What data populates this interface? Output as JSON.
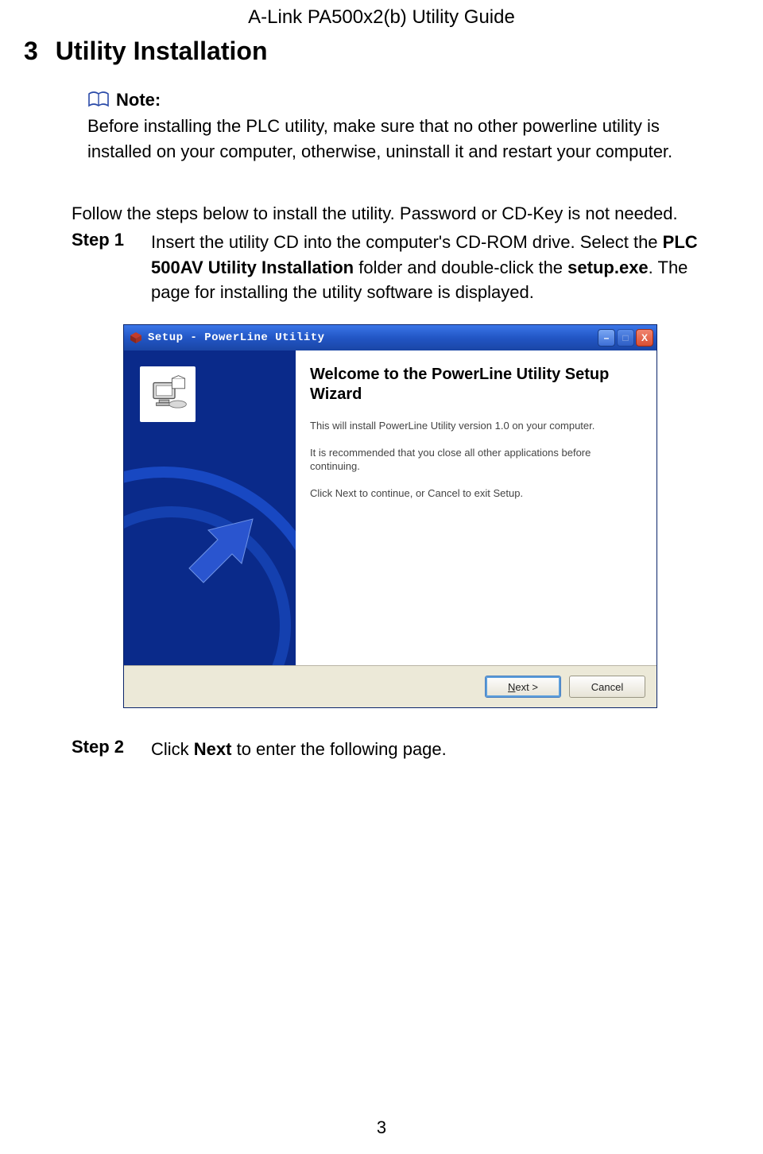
{
  "header": {
    "title": "A-Link PA500x2(b) Utility Guide"
  },
  "section": {
    "number": "3",
    "title": "Utility Installation"
  },
  "note": {
    "label": "Note:",
    "text": "Before installing the PLC utility, make sure that no other powerline utility is installed on your computer, otherwise, uninstall it and restart your computer."
  },
  "instruction": "Follow the steps below to install the utility. Password or CD-Key is not needed.",
  "step1": {
    "label": "Step 1",
    "t1": "Insert the utility CD into the computer's CD-ROM drive. Select the ",
    "b1": "PLC 500AV Utility Installation",
    "t2": " folder and double-click the ",
    "b2": "setup.exe",
    "t3": ". The page for installing the utility software is displayed."
  },
  "installer": {
    "title": "Setup - PowerLine Utility",
    "heading": "Welcome to the PowerLine Utility Setup Wizard",
    "p1": "This will install PowerLine Utility version 1.0 on your computer.",
    "p2": "It is recommended that you close all other applications before continuing.",
    "p3": "Click Next to continue, or Cancel to exit Setup.",
    "next_u": "N",
    "next_rest": "ext >",
    "cancel": "Cancel",
    "min": "–",
    "max": "□",
    "close": "X"
  },
  "step2": {
    "label": "Step 2",
    "t1": "Click ",
    "b1": "Next",
    "t2": " to enter the following page."
  },
  "page_number": "3"
}
